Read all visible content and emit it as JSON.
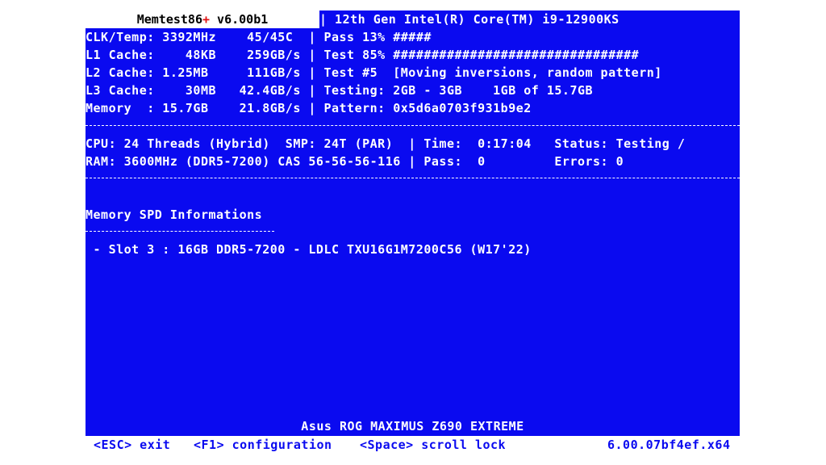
{
  "header": {
    "app_name": "Memtest86",
    "app_plus": "+",
    "app_version": " v6.00b1",
    "cpu_model": "| 12th Gen Intel(R) Core(TM) i9-12900KS"
  },
  "system_info": [
    "CLK/Temp: 3392MHz    45/45C  | Pass 13% #####",
    "L1 Cache:    48KB    259GB/s | Test 85% ################################",
    "L2 Cache: 1.25MB     111GB/s | Test #5  [Moving inversions, random pattern]",
    "L3 Cache:    30MB   42.4GB/s | Testing: 2GB - 3GB    1GB of 15.7GB",
    "Memory  : 15.7GB    21.8GB/s | Pattern: 0x5d6a0703f931b9e2"
  ],
  "status": {
    "line1": "CPU: 24 Threads (Hybrid)  SMP: 24T (PAR)  | Time:  0:17:04   Status: Testing /",
    "line2": "RAM: 3600MHz (DDR5-7200) CAS 56-56-56-116 | Pass:  0         Errors: 0"
  },
  "spd": {
    "title": "Memory SPD Informations",
    "slots": [
      " - Slot 3 : 16GB DDR5-7200 - LDLC TXU16G1M7200C56 (W17'22)"
    ]
  },
  "board_name": "Asus ROG MAXIMUS Z690 EXTREME",
  "footer": {
    "esc": "<ESC> exit",
    "f1": "<F1> configuration",
    "space": "<Space> scroll lock",
    "build": "6.00.07bf4ef.x64"
  },
  "colors": {
    "screen_bg": "#0a0af0",
    "text": "#ffffff",
    "accent_plus": "#e01010"
  }
}
